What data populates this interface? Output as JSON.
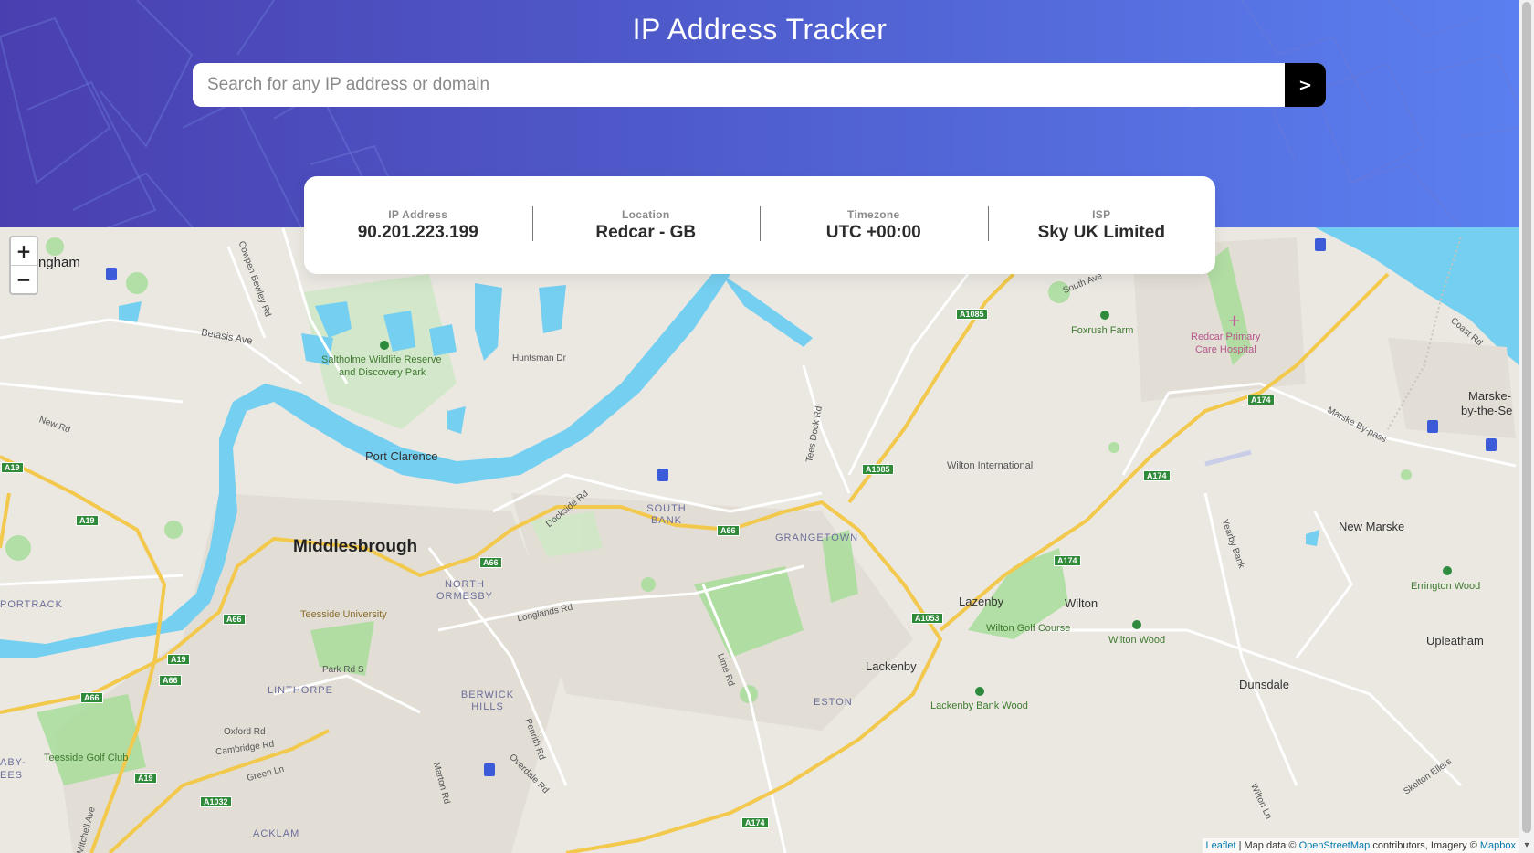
{
  "header": {
    "title": "IP Address Tracker",
    "search_placeholder": "Search for any IP address or domain",
    "search_value": "",
    "submit_label": ">"
  },
  "info": {
    "ip": {
      "label": "IP Address",
      "value": "90.201.223.199"
    },
    "location": {
      "label": "Location",
      "value": "Redcar - GB"
    },
    "timezone": {
      "label": "Timezone",
      "value": "UTC +00:00"
    },
    "isp": {
      "label": "ISP",
      "value": "Sky UK Limited"
    }
  },
  "map": {
    "zoom_in": "+",
    "zoom_out": "−",
    "labels": {
      "middlesbrough": "Middlesbrough",
      "port_clarence": "Port Clarence",
      "south_bank": "SOUTH BANK",
      "grangetown": "GRANGETOWN",
      "north_ormesby": "NORTH ORMESBY",
      "teesside_university": "Teesside University",
      "linthorpe": "LINTHORPE",
      "berwick_hills": "BERWICK HILLS",
      "eston": "ESTON",
      "lackenby": "Lackenby",
      "lazenby": "Lazenby",
      "wilton": "Wilton",
      "wilton_golf": "Wilton Golf Course",
      "wilton_wood": "Wilton Wood",
      "lackenby_bank_wood": "Lackenby Bank Wood",
      "wilton_international": "Wilton International",
      "new_marske": "New Marske",
      "errington_wood": "Errington Wood",
      "upleatham": "Upleatham",
      "dunsdale": "Dunsdale",
      "foxrush_farm": "Foxrush Farm",
      "redcar_hospital_1": "Redcar Primary",
      "redcar_hospital_2": "Care Hospital",
      "saltholme_1": "Saltholme Wildlife Reserve",
      "saltholme_2": "and Discovery Park",
      "huntsman_dr": "Huntsman Dr",
      "belasis_ave": "Belasis Ave",
      "teesside_golf": "Teesside Golf Club",
      "acklam": "ACKLAM",
      "portrack": "PORTRACK",
      "park_rd_s": "Park Rd S",
      "oxford_rd": "Oxford Rd",
      "cambridge_rd": "Cambridge Rd",
      "green_ln": "Green Ln",
      "longlands_rd": "Longlands Rd",
      "dockside_rd": "Dockside Rd",
      "tees_dock_rd": "Tees Dock Rd",
      "marske_1": "Marske-",
      "marske_2": "by-the-Se",
      "billingham": "ngham",
      "new_rd": "New Rd",
      "cowpen_bewley_rd": "Cowpen Bewley Rd",
      "marske_bypass": "Marske By-pass",
      "yearby_bank": "Yearby Bank",
      "south_ave": "South Ave",
      "coast_rd": "Coast Rd",
      "skelton_ellers": "Skelton Ellers",
      "marton_rd": "Marton Rd",
      "penrith_rd": "Penrith Rd",
      "overdale_rd": "Overdale Rd",
      "lime_rd": "Lime Rd",
      "wilton_ln": "Wilton Ln",
      "mitchell_ave": "Mitchell Ave",
      "aby_ees_1": "ABY-",
      "aby_ees_2": "EES"
    },
    "road_shields": [
      "A19",
      "A19",
      "A19",
      "A19",
      "A66",
      "A66",
      "A66",
      "A66",
      "A66",
      "A66",
      "A1085",
      "A1085",
      "A174",
      "A174",
      "A174",
      "A174",
      "A1053",
      "A1032"
    ]
  },
  "attribution": {
    "leaflet": "Leaflet",
    "text1": " | Map data © ",
    "osm": "OpenStreetMap",
    "text2": " contributors, Imagery © ",
    "mapbox": "Mapbox"
  },
  "colors": {
    "header_start": "#4a3fb0",
    "header_end": "#5b7ff0",
    "water": "#75cff0",
    "land": "#e9e6e0",
    "park": "#a8dd9a",
    "motorway": "#f2c94c"
  }
}
